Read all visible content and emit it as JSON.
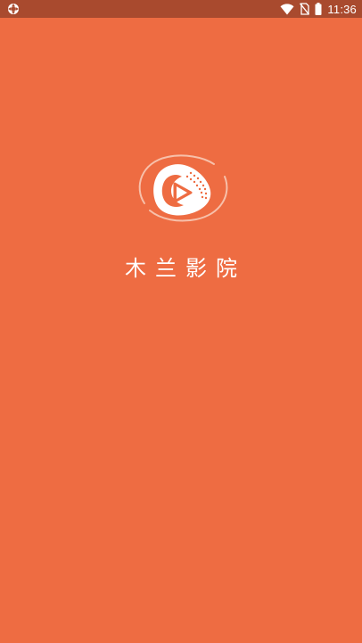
{
  "status_bar": {
    "time": "11:36",
    "left_icon": "app-notification-icon",
    "icons": [
      "wifi-icon",
      "no-sim-icon",
      "battery-icon"
    ]
  },
  "splash": {
    "app_name": "木兰影院",
    "logo_icon": "film-play-logo-icon"
  },
  "colors": {
    "background": "#EE6C42",
    "status_bar": "#A94A2E",
    "text": "#FFFFFF"
  }
}
